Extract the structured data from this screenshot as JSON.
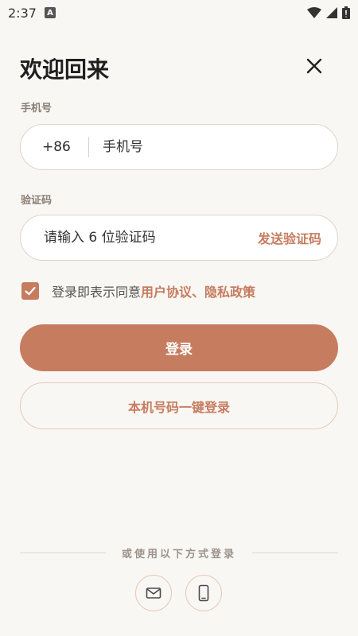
{
  "status_bar": {
    "time": "2:37",
    "notification_badge": "A",
    "icons": [
      "wifi-icon",
      "cell-signal-icon",
      "battery-icon"
    ]
  },
  "header": {
    "title": "欢迎回来",
    "close_icon": "close-icon"
  },
  "phone_field": {
    "label": "手机号",
    "country_code": "+86",
    "placeholder": "手机号",
    "value": ""
  },
  "code_field": {
    "label": "验证码",
    "placeholder": "请输入 6 位验证码",
    "value": "",
    "send_label": "发送验证码"
  },
  "agreement": {
    "checked": true,
    "prefix": "登录即表示同意",
    "terms_link": "用户协议",
    "separator": "、",
    "privacy_link": "隐私政策"
  },
  "actions": {
    "login_label": "登录",
    "one_click_label": "本机号码一键登录"
  },
  "alternatives": {
    "divider_text": "或使用以下方式登录",
    "options": [
      {
        "icon": "mail-icon"
      },
      {
        "icon": "phone-icon"
      }
    ]
  },
  "colors": {
    "accent": "#c67c5f",
    "background": "#f9f7f4",
    "field_border": "#e3d3c8",
    "label": "#8a7e75"
  }
}
